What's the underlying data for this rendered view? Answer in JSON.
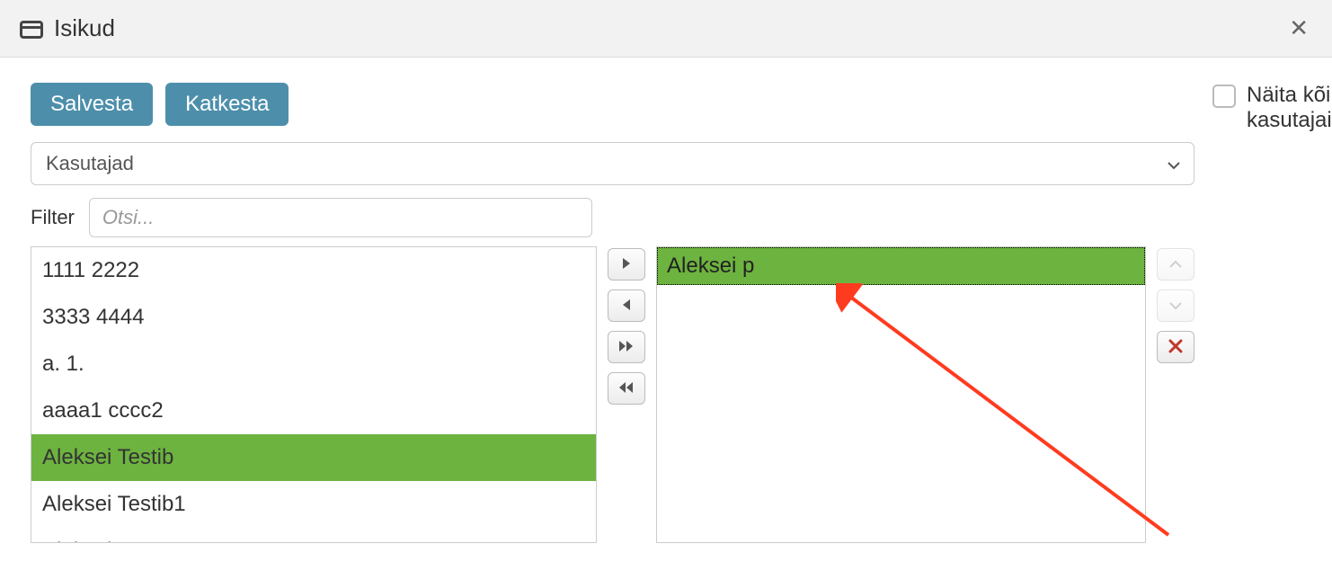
{
  "header": {
    "title": "Isikud"
  },
  "buttons": {
    "save": "Salvesta",
    "cancel": "Katkesta"
  },
  "select": {
    "value": "Kasutajad"
  },
  "filter": {
    "label": "Filter",
    "placeholder": "Otsi..."
  },
  "checkbox": {
    "label": "Näita kõikide üksuste kasutajaid/kasutajagruppe"
  },
  "available": {
    "items": [
      {
        "label": "1111 2222",
        "selected": false
      },
      {
        "label": "3333 4444",
        "selected": false
      },
      {
        "label": "a. 1.",
        "selected": false
      },
      {
        "label": "aaaa1 cccc2",
        "selected": false
      },
      {
        "label": "Aleksei Testib",
        "selected": true
      },
      {
        "label": "Aleksei Testib1",
        "selected": false
      },
      {
        "label": "Aleksei New",
        "selected": false
      }
    ]
  },
  "chosen": {
    "items": [
      {
        "label": "Aleksei p",
        "selected": true
      }
    ]
  }
}
